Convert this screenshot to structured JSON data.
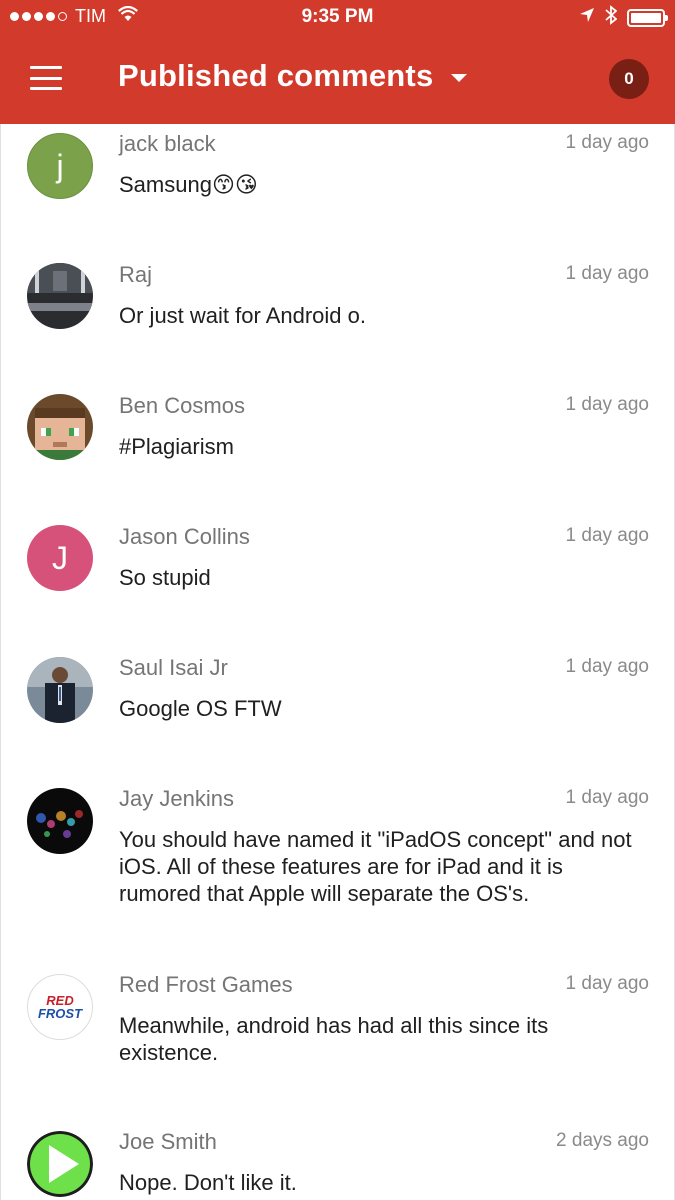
{
  "status_bar": {
    "carrier": "TIM",
    "time": "9:35 PM"
  },
  "app_bar": {
    "title": "Published comments",
    "count": "0"
  },
  "colors": {
    "brand": "#d23a2b",
    "badge": "#7a1f14"
  },
  "comments": [
    {
      "author": "jack black",
      "time": "1 day ago",
      "text": "Samsung😙😘",
      "avatar_letter": "j",
      "avatar_color": "#7ba24a"
    },
    {
      "author": "Raj",
      "time": "1 day ago",
      "text": "Or just wait for Android o.",
      "avatar_letter": "",
      "avatar_color": "#3a3d42"
    },
    {
      "author": "Ben Cosmos",
      "time": "1 day ago",
      "text": "#Plagiarism",
      "avatar_letter": "",
      "avatar_color": "#6b4a2b"
    },
    {
      "author": "Jason Collins",
      "time": "1 day ago",
      "text": "So stupid",
      "avatar_letter": "J",
      "avatar_color": "#d6527a"
    },
    {
      "author": "Saul Isai Jr",
      "time": "1 day ago",
      "text": "Google OS FTW",
      "avatar_letter": "",
      "avatar_color": "#5a6b7e"
    },
    {
      "author": "Jay Jenkins",
      "time": "1 day ago",
      "text": "You should have named it \"iPadOS concept\" and not iOS. All of these features are for iPad and it is rumored that Apple will separate the OS's.",
      "avatar_letter": "",
      "avatar_color": "#111111"
    },
    {
      "author": "Red Frost Games",
      "time": "1 day ago",
      "text": "Meanwhile, android has had all this since its existence.",
      "avatar_letter": "",
      "avatar_color": "#ffffff",
      "avatar_logo_top": "RED",
      "avatar_logo_bottom": "FROST"
    },
    {
      "author": "Joe Smith",
      "time": "2 days ago",
      "text": "Nope. Don't like it.",
      "avatar_letter": "",
      "avatar_color": "#1e1e1e"
    }
  ]
}
